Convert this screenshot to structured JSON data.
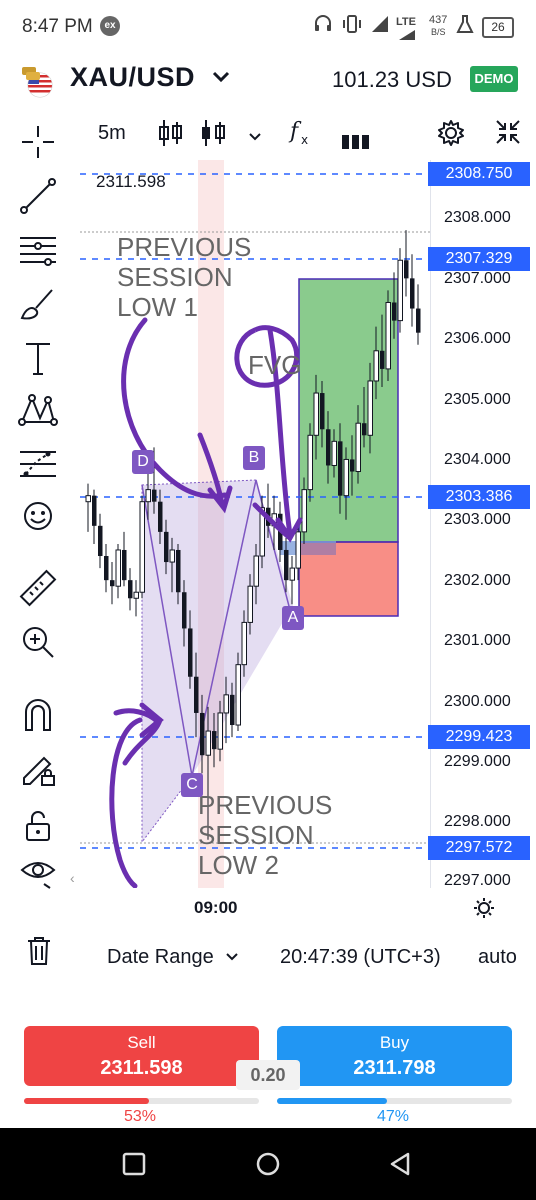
{
  "status_bar": {
    "time": "8:47 PM",
    "ex_badge": "ex",
    "network": "LTE",
    "speed_value": "437",
    "speed_unit": "B/S",
    "battery": "26",
    "icons": [
      "headset-icon",
      "vibrate-icon",
      "signal-icon",
      "wifi-signal-icon",
      "flask-icon"
    ]
  },
  "header": {
    "symbol": "XAU/USD",
    "balance": "101.23 USD",
    "account_type": "DEMO"
  },
  "toolbar": {
    "interval": "5m",
    "icons": [
      "candle-type-icon",
      "candles-icon",
      "chevron-down-icon",
      "indicators-fx-icon",
      "more-bars-icon",
      "settings-gear-icon",
      "fullscreen-icon"
    ]
  },
  "left_tools": [
    "crosshair-icon",
    "trend-line-icon",
    "fib-lines-icon",
    "brush-icon",
    "text-tool-icon",
    "pattern-icon",
    "forecast-icon",
    "emoji-icon",
    "ruler-icon",
    "zoom-in-icon",
    "magnet-icon",
    "lock-drawing-icon",
    "unlock-icon",
    "eye-icon"
  ],
  "chart": {
    "ohlc_label": "2311.598",
    "annotation_1": [
      "PREVIOUS",
      "SESSION",
      "LOW 1"
    ],
    "annotation_2": [
      "PREVIOUS",
      "SESSION",
      "LOW 2"
    ],
    "fvg_label": "FVG",
    "points": [
      "D",
      "B",
      "C",
      "A"
    ],
    "time_label": "09:00",
    "colors": {
      "bull": "#131722",
      "bear": "#131722",
      "pattern": "#7e57c2",
      "long_tp": "#4caf50",
      "long_sl": "#f44336",
      "dashed": "#2962ff",
      "drawing": "#6a2fb0"
    }
  },
  "price_axis": {
    "labels": [
      "2308.000",
      "2307.000",
      "2306.000",
      "2305.000",
      "2304.000",
      "2303.000",
      "2302.000",
      "2301.000",
      "2300.000",
      "2299.000",
      "2298.000",
      "2297.000"
    ],
    "tags": [
      "2308.750",
      "2307.329",
      "2303.386",
      "2299.423",
      "2297.572"
    ]
  },
  "bottom_bar": {
    "date_range": "Date Range",
    "clock": "20:47:39 (UTC+3)",
    "scale": "auto"
  },
  "trade": {
    "sell_label": "Sell",
    "sell_price": "2311.598",
    "buy_label": "Buy",
    "buy_price": "2311.798",
    "spread": "0.20",
    "sell_pct_label": "53%",
    "buy_pct_label": "47%",
    "sell_fraction": 0.53,
    "buy_fraction": 0.47
  }
}
